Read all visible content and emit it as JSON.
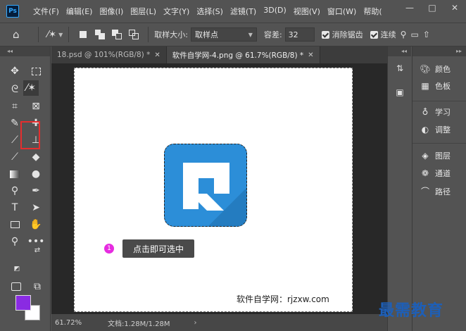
{
  "app": {
    "logo": "Ps"
  },
  "menu": [
    "文件(F)",
    "编辑(E)",
    "图像(I)",
    "图层(L)",
    "文字(Y)",
    "选择(S)",
    "滤镜(T)",
    "3D(D)",
    "视图(V)",
    "窗口(W)",
    "帮助("
  ],
  "window_controls": {
    "minimize": "—",
    "maximize": "□",
    "close": "✕"
  },
  "options": {
    "sample_size_label": "取样大小:",
    "sample_size_value": "取样点",
    "tolerance_label": "容差:",
    "tolerance_value": "32",
    "anti_alias_label": "消除锯齿",
    "contiguous_label": "连续"
  },
  "tabs": [
    {
      "label": "18.psd @ 101%(RGB/8) *",
      "close": "✕"
    },
    {
      "label": "软件自学网-4.png @ 61.7%(RGB/8) *",
      "close": "✕"
    }
  ],
  "canvas": {
    "callout_number": "1",
    "callout_text": "点击即可选中",
    "watermark": "软件自学网：rjzxw.com"
  },
  "colors": {
    "foreground": "#8a2be2",
    "background": "#ffffff",
    "logo_blue": "#2c8ed8",
    "callout_dot": "#e62ce0",
    "highlight": "#e52e2e"
  },
  "status": {
    "zoom": "61.72%",
    "doc_info": "文档:1.28M/1.28M",
    "arrow": "›"
  },
  "panels": [
    {
      "icon": "palette-icon",
      "label": "颜色"
    },
    {
      "icon": "swatches-icon",
      "label": "色板"
    },
    {
      "icon": "bulb-icon",
      "label": "学习"
    },
    {
      "icon": "adjust-icon",
      "label": "调整"
    },
    {
      "icon": "layers-icon",
      "label": "图层"
    },
    {
      "icon": "channels-icon",
      "label": "通道"
    },
    {
      "icon": "paths-icon",
      "label": "路径"
    }
  ],
  "brand": "最需教育"
}
